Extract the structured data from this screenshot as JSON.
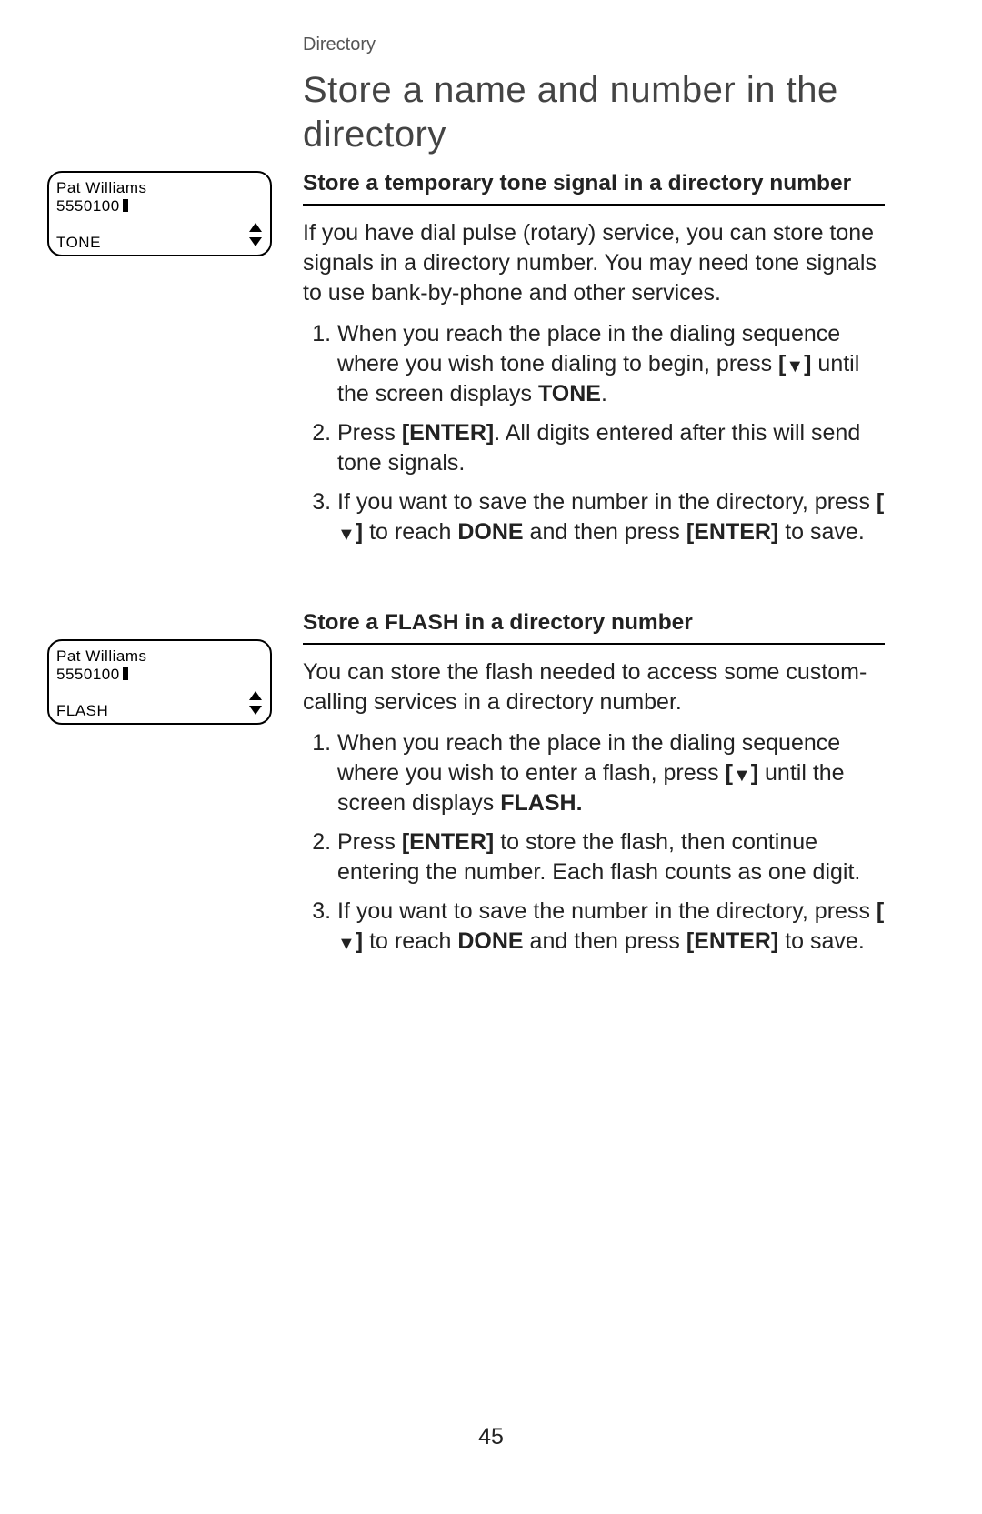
{
  "header": {
    "section": "Directory",
    "title": "Store a name and number in the directory"
  },
  "tone": {
    "subhead": "Store a temporary tone signal in a directory number",
    "intro": "If you have dial pulse (rotary) service, you can store tone signals in a directory number. You may need tone signals to use bank-by-phone and other services.",
    "step1_a": "When you reach the place in the dialing sequence where you wish tone dialing to begin, press ",
    "step1_b": " until the screen displays ",
    "step1_tone": "TONE",
    "step1_c": ".",
    "step2_a": "Press ",
    "step2_enter": "[ENTER]",
    "step2_b": ". All digits entered after this will send tone signals.",
    "step3_a": "If you want to save the number in the directory, press ",
    "step3_b": " to reach ",
    "step3_done": "DONE",
    "step3_c": " and then press ",
    "step3_enter": "[ENTER]",
    "step3_d": " to save."
  },
  "flash": {
    "subhead": "Store a FLASH in a directory number",
    "intro": "You can store the flash needed to access some custom-calling services in a directory number.",
    "step1_a": "When you reach the place in the dialing sequence where you wish to enter a flash, press ",
    "step1_b": " until the screen displays ",
    "step1_flash": "FLASH.",
    "step2_a": "Press ",
    "step2_enter": "[ENTER]",
    "step2_b": " to store the flash, then continue entering the number. Each flash counts as one digit.",
    "step3_a": "If you want to save the number in the directory, press ",
    "step3_b": " to reach ",
    "step3_done": "DONE",
    "step3_c": " and then press ",
    "step3_enter": "[ENTER]",
    "step3_d": " to save."
  },
  "lcd": {
    "name": "Pat Williams",
    "number": "5550100",
    "tone": "TONE",
    "flash": "FLASH"
  },
  "page_number": "45",
  "glyph": {
    "down_bracket_open": "[",
    "down_bracket_close": "]"
  }
}
